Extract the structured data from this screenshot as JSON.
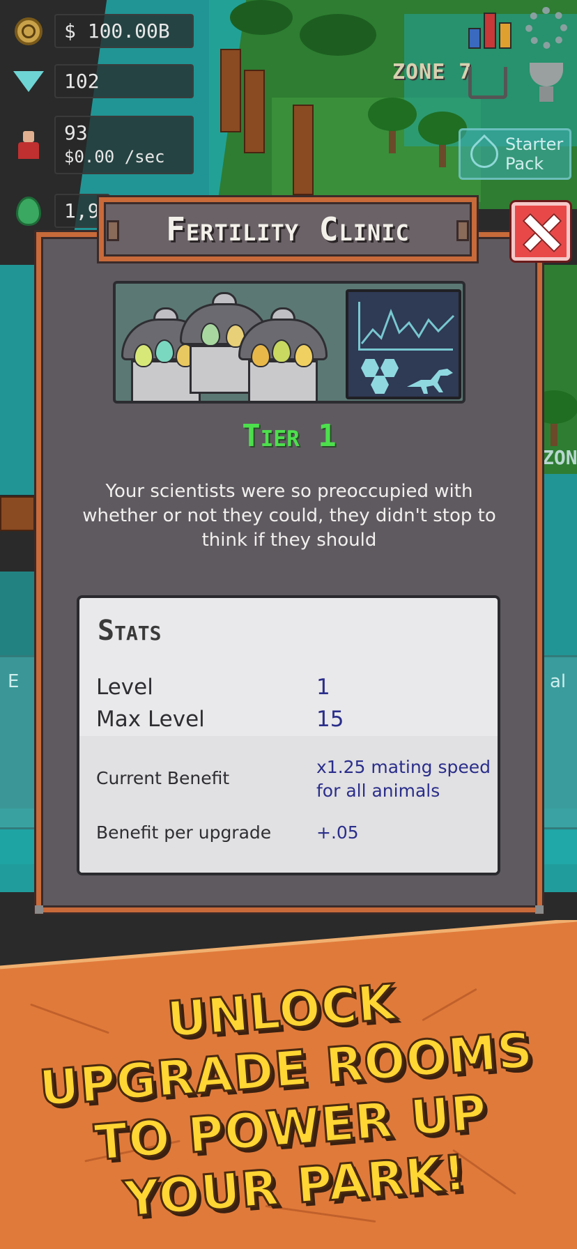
{
  "hud": {
    "money": "$ 100.00B",
    "gems": "102",
    "visitors": "93",
    "visitor_rate": "$0.00 /sec",
    "eggs": "1,9"
  },
  "world": {
    "zone_label": "ZONE 7",
    "zone_label_right": "ZON",
    "starter_pack_label": "Starter Pack",
    "side_card_left": "E",
    "side_card_right": "al"
  },
  "modal": {
    "title": "Fertility Clinic",
    "tier": "Tier 1",
    "description": "Your scientists were so preoccupied with whether or not they could, they didn't stop to think if they should",
    "stats": {
      "heading": "Stats",
      "level_label": "Level",
      "level_value": "1",
      "max_level_label": "Max Level",
      "max_level_value": "15",
      "current_benefit_label": "Current Benefit",
      "current_benefit_value": "x1.25 mating speed for all animals",
      "benefit_per_upgrade_label": "Benefit per upgrade",
      "benefit_per_upgrade_value": "+.05"
    }
  },
  "promo": {
    "line1": "UNLOCK",
    "line2": "UPGRADE ROOMS",
    "line3": "TO POWER UP",
    "line4": "YOUR PARK!"
  },
  "colors": {
    "frame": "#c86a3a",
    "panel": "#5f5a60",
    "tier_green": "#4de04d",
    "promo_yellow": "#ffd633",
    "banner_orange": "#e07a3a",
    "close_red": "#e84848",
    "stat_value_blue": "#2a2e8a"
  },
  "icons": [
    "coin-icon",
    "gem-icon",
    "visitor-icon",
    "egg-icon",
    "stats-chart-icon",
    "settings-gear-icon",
    "shop-cart-icon",
    "trophy-icon",
    "starter-pack-icon",
    "close-icon"
  ]
}
